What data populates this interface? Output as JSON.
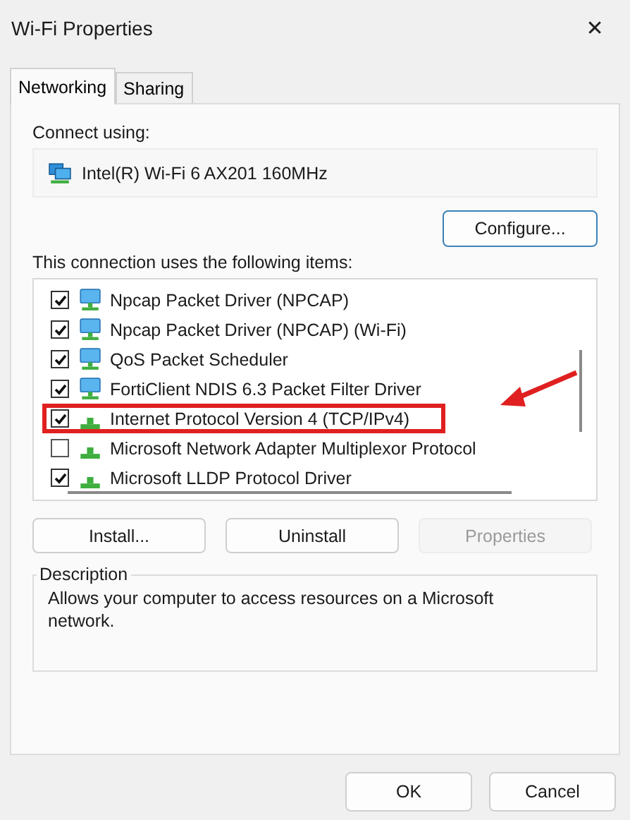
{
  "window": {
    "title": "Wi-Fi Properties",
    "close": "✕"
  },
  "tabs": [
    {
      "label": "Networking",
      "selected": true
    },
    {
      "label": "Sharing",
      "selected": false
    }
  ],
  "connect_using": {
    "label": "Connect using:",
    "adapter": "Intel(R) Wi-Fi 6 AX201 160MHz",
    "configure": "Configure..."
  },
  "items_label": "This connection uses the following items:",
  "items": [
    {
      "label": "Npcap Packet Driver (NPCAP)",
      "kind": "service",
      "checked": true,
      "highlighted": false
    },
    {
      "label": "Npcap Packet Driver (NPCAP) (Wi-Fi)",
      "kind": "service",
      "checked": true,
      "highlighted": false
    },
    {
      "label": "QoS Packet Scheduler",
      "kind": "service",
      "checked": true,
      "highlighted": false
    },
    {
      "label": "FortiClient NDIS 6.3 Packet Filter Driver",
      "kind": "service",
      "checked": true,
      "highlighted": false
    },
    {
      "label": "Internet Protocol Version 4 (TCP/IPv4)",
      "kind": "protocol",
      "checked": true,
      "highlighted": true
    },
    {
      "label": "Microsoft Network Adapter Multiplexor Protocol",
      "kind": "protocol",
      "checked": false,
      "highlighted": false
    },
    {
      "label": "Microsoft LLDP Protocol Driver",
      "kind": "protocol",
      "checked": true,
      "highlighted": false
    }
  ],
  "item_buttons": [
    {
      "label": "Install...",
      "disabled": false
    },
    {
      "label": "Uninstall",
      "disabled": false
    },
    {
      "label": "Properties",
      "disabled": true
    }
  ],
  "description": {
    "title": "Description",
    "text": "Allows your computer to access resources on a Microsoft network."
  },
  "footer_buttons": [
    "OK",
    "Cancel"
  ]
}
